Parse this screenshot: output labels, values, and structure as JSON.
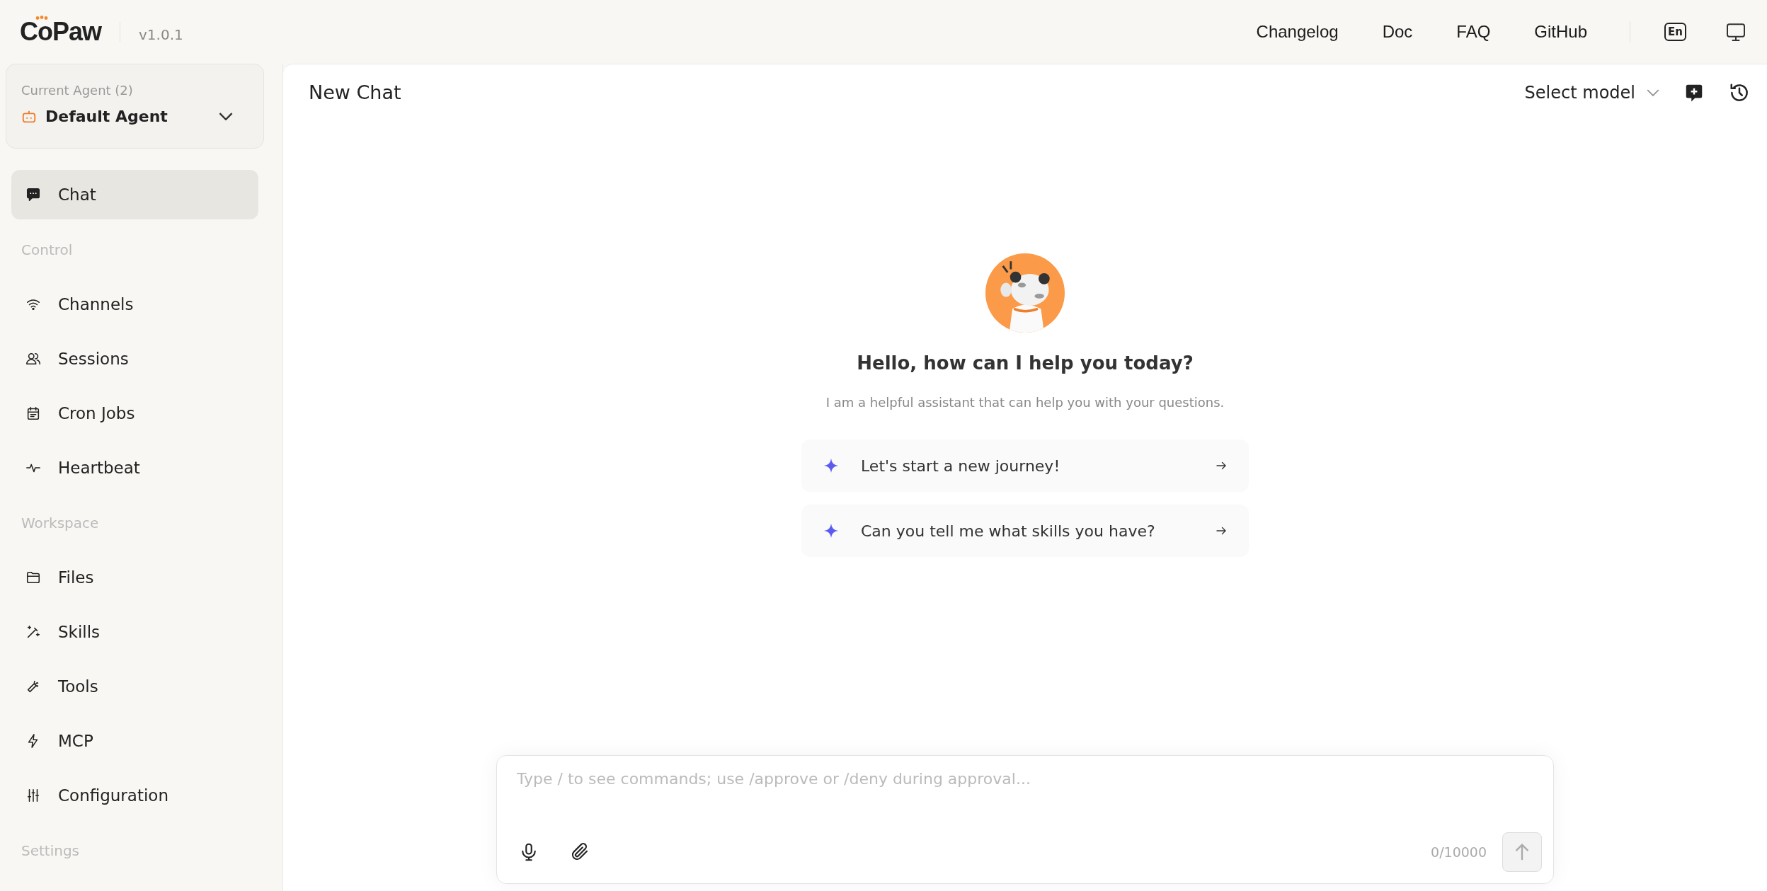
{
  "header": {
    "logo": "CoPaw",
    "version": "v1.0.1",
    "links": [
      "Changelog",
      "Doc",
      "FAQ",
      "GitHub"
    ],
    "language": "En"
  },
  "agent_selector": {
    "label": "Current Agent (2)",
    "value": "Default Agent"
  },
  "nav": [
    {
      "kind": "item",
      "label": "Chat",
      "selected": true
    },
    {
      "kind": "section",
      "label": "Control"
    },
    {
      "kind": "item",
      "label": "Channels",
      "selected": false
    },
    {
      "kind": "item",
      "label": "Sessions",
      "selected": false
    },
    {
      "kind": "item",
      "label": "Cron Jobs",
      "selected": false
    },
    {
      "kind": "item",
      "label": "Heartbeat",
      "selected": false
    },
    {
      "kind": "section",
      "label": "Workspace"
    },
    {
      "kind": "item",
      "label": "Files",
      "selected": false
    },
    {
      "kind": "item",
      "label": "Skills",
      "selected": false
    },
    {
      "kind": "item",
      "label": "Tools",
      "selected": false
    },
    {
      "kind": "item",
      "label": "MCP",
      "selected": false
    },
    {
      "kind": "item",
      "label": "Configuration",
      "selected": false
    },
    {
      "kind": "section",
      "label": "Settings"
    }
  ],
  "chat": {
    "title": "New Chat",
    "model_select": "Select model",
    "greeting": "Hello, how can I help you today?",
    "subtitle": "I am a helpful assistant that can help you with your questions.",
    "suggestions": [
      "Let's start a new journey!",
      "Can you tell me what skills you have?"
    ],
    "input": {
      "placeholder": "Type / to see commands; use /approve or /deny during approval...",
      "counter": "0/10000"
    }
  }
}
